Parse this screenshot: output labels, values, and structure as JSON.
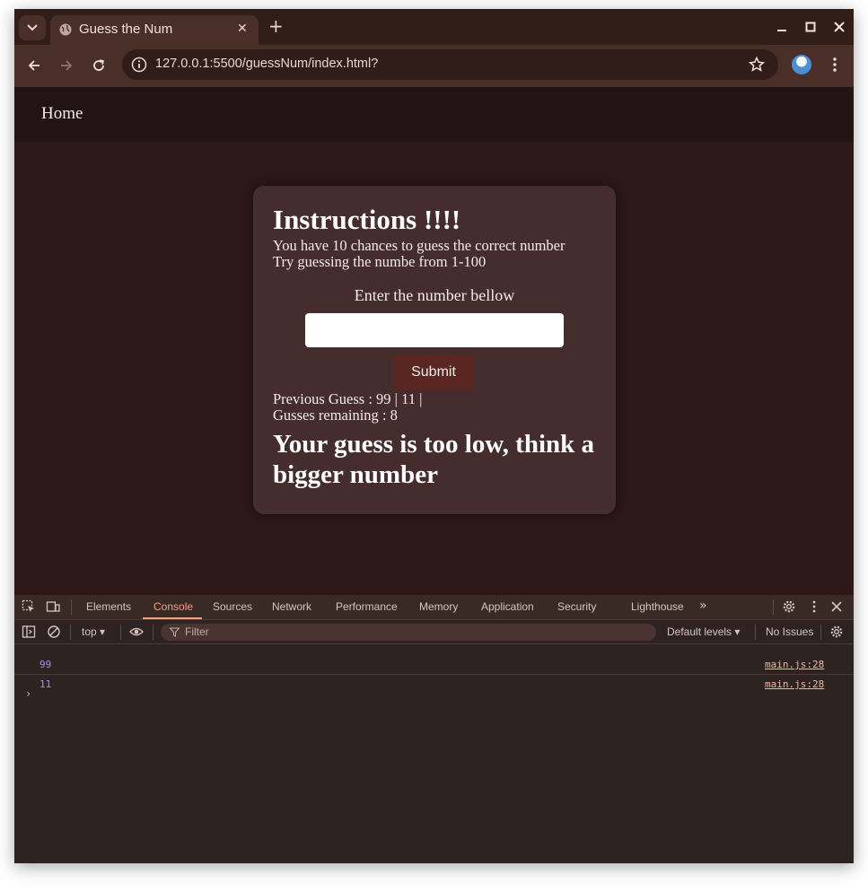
{
  "browser": {
    "tab_title": "Guess the Num",
    "close_tab": "✕",
    "new_tab": "+",
    "url": "127.0.0.1:5500/guessNum/index.html?"
  },
  "page": {
    "nav": {
      "home": "Home"
    },
    "card": {
      "title": "Instructions !!!!",
      "line1": "You have 10 chances to guess the correct number",
      "line2": "Try guessing the numbe from 1-100",
      "enter_label": "Enter the number bellow",
      "input_value": "",
      "submit_label": "Submit",
      "previous_guess": "Previous Guess : 99 | 11 |",
      "remaining": "Gusses remaining : 8",
      "result": "Your guess is too low, think a bigger number"
    }
  },
  "devtools": {
    "tabs": [
      "Elements",
      "Console",
      "Sources",
      "Network",
      "Performance",
      "Memory",
      "Application",
      "Security",
      "Lighthouse"
    ],
    "active_tab": "Console",
    "context": "top ▾",
    "filter_placeholder": "Filter",
    "levels": "Default levels ▾",
    "issues": "No Issues",
    "logs": [
      {
        "value": "99",
        "source": "main.js:28"
      },
      {
        "value": "11",
        "source": "main.js:28"
      }
    ],
    "prompt": "›"
  },
  "colors": {
    "accent": "#f0a089",
    "page_bg": "#2b1817",
    "card_bg": "#442d2c",
    "submit_bg": "#5a2622"
  }
}
